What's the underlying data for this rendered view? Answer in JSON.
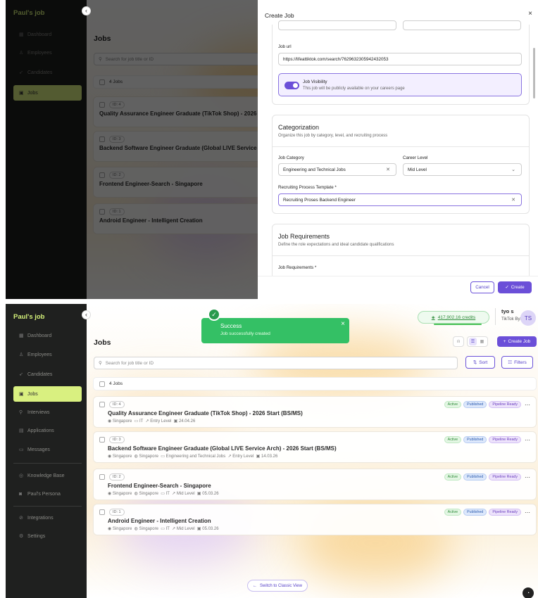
{
  "app": {
    "logo": "Paul's job",
    "collapse_icon": "chevron-left-icon"
  },
  "sidebar": {
    "items": [
      {
        "label": "Dashboard",
        "icon": "grid-icon"
      },
      {
        "label": "Employees",
        "icon": "person-icon"
      },
      {
        "label": "Candidates",
        "icon": "rocket-icon"
      },
      {
        "label": "Jobs",
        "icon": "briefcase-icon",
        "active": true
      },
      {
        "label": "Interviews",
        "icon": "pin-icon"
      },
      {
        "label": "Applications",
        "icon": "document-icon"
      },
      {
        "label": "Messages",
        "icon": "chat-icon"
      },
      {
        "label": "Knowledge Base",
        "icon": "book-icon"
      },
      {
        "label": "Paul's Persona",
        "icon": "robot-icon"
      },
      {
        "label": "Integrations",
        "icon": "plug-icon"
      },
      {
        "label": "Settings",
        "icon": "gear-icon"
      }
    ]
  },
  "header": {
    "credits": "417,902.16 credits",
    "user_name": "tyo s",
    "user_org": "TikTok Bytedance",
    "avatar_initials": "TS"
  },
  "toast": {
    "title": "Success",
    "message": "Job successfully created",
    "close": "×",
    "icon": "check-circle-icon"
  },
  "jobs": {
    "title": "Jobs",
    "create_label": "Create Job",
    "search_placeholder": "Search for job title or ID",
    "sort_label": "Sort",
    "filters_label": "Filters",
    "count_label": "4 Jobs",
    "classic_view": "Switch to Classic View",
    "list": [
      {
        "id": "ID: 4",
        "title": "Quality Assurance Engineer Graduate (TikTok Shop) - 2026 Start (BS/MS)",
        "location": "Singapore",
        "dept": "IT",
        "level": "Entry Level",
        "date": "24.04.26"
      },
      {
        "id": "ID: 3",
        "title": "Backend Software Engineer Graduate (Global LIVE Service Arch) - 2026 Start (BS/MS)",
        "location": "Singapore",
        "location2": "Singapore",
        "dept": "Engineering and Technical Jobs",
        "level": "Entry Level",
        "date": "14.03.26"
      },
      {
        "id": "ID: 2",
        "title": "Frontend Engineer-Search - Singapore",
        "location": "Singapore",
        "location2": "Singapore",
        "dept": "IT",
        "level": "Mid Level",
        "date": "05.03.26"
      },
      {
        "id": "ID: 1",
        "title": "Android Engineer - Intelligent Creation",
        "location": "Singapore",
        "location2": "Singapore",
        "dept": "IT",
        "level": "Mid Level",
        "date": "05.03.26"
      }
    ],
    "badges": {
      "active": "Active",
      "published": "Published",
      "pipeline": "Pipeline Ready"
    }
  },
  "modal": {
    "title": "Create Job",
    "close": "×",
    "job_url_label": "Job url",
    "job_url_value": "https://lifeattiktok.com/search/7629632305942432053",
    "visibility_title": "Job Visibility",
    "visibility_desc": "This job will be publicly available on your careers page",
    "categorization_title": "Categorization",
    "categorization_sub": "Organize this job by category, level, and recruiting process",
    "job_category_label": "Job Category",
    "job_category_value": "Engineering and Technical Jobs",
    "career_level_label": "Career Level",
    "career_level_value": "Mid Level",
    "recruiting_label": "Recruiting Process Template *",
    "recruiting_value": "Recruiting Proses Backend Engineer",
    "requirements_title": "Job Requirements",
    "requirements_sub": "Define the role expectations and ideal candidate qualifications",
    "requirements_label": "Job Requirements *",
    "cancel": "Cancel",
    "create": "Create"
  },
  "colors": {
    "accent": "#6b4fd8",
    "sidebar_bg": "#1f201f",
    "active_nav": "#d9f080",
    "success": "#34c065"
  }
}
